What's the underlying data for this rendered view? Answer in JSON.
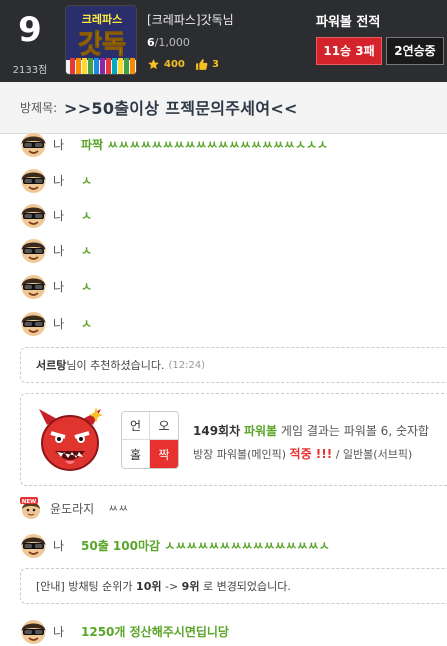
{
  "header": {
    "rank": "9",
    "points": "2133점",
    "logo_text": "크레파스",
    "logo_big": "갓독",
    "user_name": "[크레파스]갓독님",
    "user_count_current": "6",
    "user_count_total": "/1,000",
    "stat_stars": "400",
    "stat_likes": "3",
    "powerball_title": "파워볼 전적",
    "record_button": "11승 3패",
    "streak_button": "2연승중"
  },
  "room": {
    "label": "방제목:",
    "title": ">>50출이상 프젝문의주세여<<"
  },
  "messages": [
    {
      "sender": "나",
      "text": "파짝 ㅆㅆㅆㅆㅆㅆㅆㅆㅆㅆㅆㅆㅆㅆㅆㅆㅆㅅㅅㅅ"
    },
    {
      "sender": "나",
      "text": "ㅅ"
    },
    {
      "sender": "나",
      "text": "ㅅ"
    },
    {
      "sender": "나",
      "text": "ㅅ"
    },
    {
      "sender": "나",
      "text": "ㅅ"
    },
    {
      "sender": "나",
      "text": "ㅅ"
    }
  ],
  "recommend": {
    "name": "서르탕",
    "suffix": "님이 추천하셨습니다.",
    "time": "(12:24)"
  },
  "result": {
    "grid": [
      "언",
      "오",
      "홀",
      "짝"
    ],
    "round": "149회차",
    "game": "파워볼",
    "line1_rest": "게임 결과는 파워볼 6, 숫자합",
    "line2_prefix": "방장 파워볼(메인픽)",
    "line2_hit": "적중 !!!",
    "line2_suffix": "/ 일반볼(서브픽)"
  },
  "messages2": [
    {
      "sender": "윤도라지",
      "text": "ㅆㅆ"
    },
    {
      "sender": "나",
      "text": "50출 100마감 ㅅㅆㅆㅆㅆㅆㅆㅆㅆㅆㅆㅆㅆㅆㅅ"
    }
  ],
  "announce": {
    "prefix": "[안내] 방채팅 순위가",
    "from": "10위",
    "arrow": "->",
    "to": "9위",
    "suffix": "로 변경되었습니다."
  },
  "last_message": {
    "sender": "나",
    "text": "1250개 정산해주시면딥니당"
  },
  "colors": {
    "header_bg": "#2b2d30",
    "green_text": "#5aa52a",
    "red_accent": "#e7312f",
    "win_button": "#d4232b"
  }
}
